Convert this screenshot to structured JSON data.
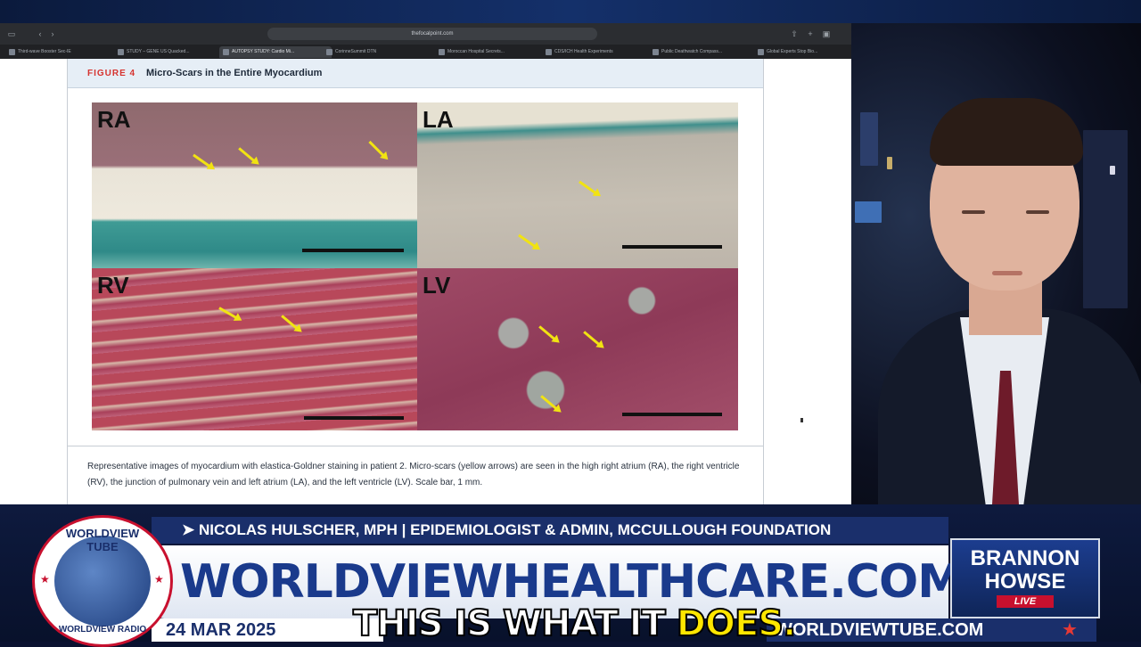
{
  "browser": {
    "url": "thefocalpoint.com",
    "tabs": [
      "Third-wave Booster Sec-IE",
      "STUDY – GENE US Quacked...",
      "AUTOPSY STUDY: Cardio Mi...",
      "CorinneSummit DTN",
      "Moroccan Hospital Secrets...",
      "CDS/ICH Health Experiments",
      "Public Deathwatch Compass...",
      "Global Experts Stop Bio..."
    ]
  },
  "figure": {
    "number": "FIGURE 4",
    "title": "Micro-Scars in the Entire Myocardium",
    "panels": [
      {
        "label": "RA"
      },
      {
        "label": "LA"
      },
      {
        "label": "RV"
      },
      {
        "label": "LV"
      }
    ],
    "caption": "Representative images of myocardium with elastica-Goldner staining in patient 2. Micro-scars (yellow arrows) are seen in the high right atrium (RA), the right ventricle (RV), the junction of pulmonary vein and left atrium (LA), and the left ventricle (LV). Scale bar, 1 mm."
  },
  "broadcast": {
    "ticker": "➤ NICOLAS HULSCHER, MPH | EPIDEMIOLOGIST & ADMIN, MCCULLOUGH FOUNDATION",
    "headline": "WORLDVIEWHEALTHCARE.COM",
    "date": "24 MAR 2025",
    "site": "WORLDVIEWTUBE.COM",
    "logo": {
      "top": "WORLDVIEW TUBE",
      "bottom": "WORLDVIEW RADIO"
    },
    "show": {
      "line1": "BRANNON",
      "line2": "HOWSE",
      "badge": "LIVE"
    },
    "subtitle": {
      "part1": "THIS IS WHAT IT ",
      "part2": "DOES."
    }
  },
  "colors": {
    "figure_number": "#d6332f",
    "navy": "#1a2f6b",
    "headline": "#1a3a8c",
    "arrow": "#f1e312",
    "subtitle_highlight": "#ffe600"
  }
}
